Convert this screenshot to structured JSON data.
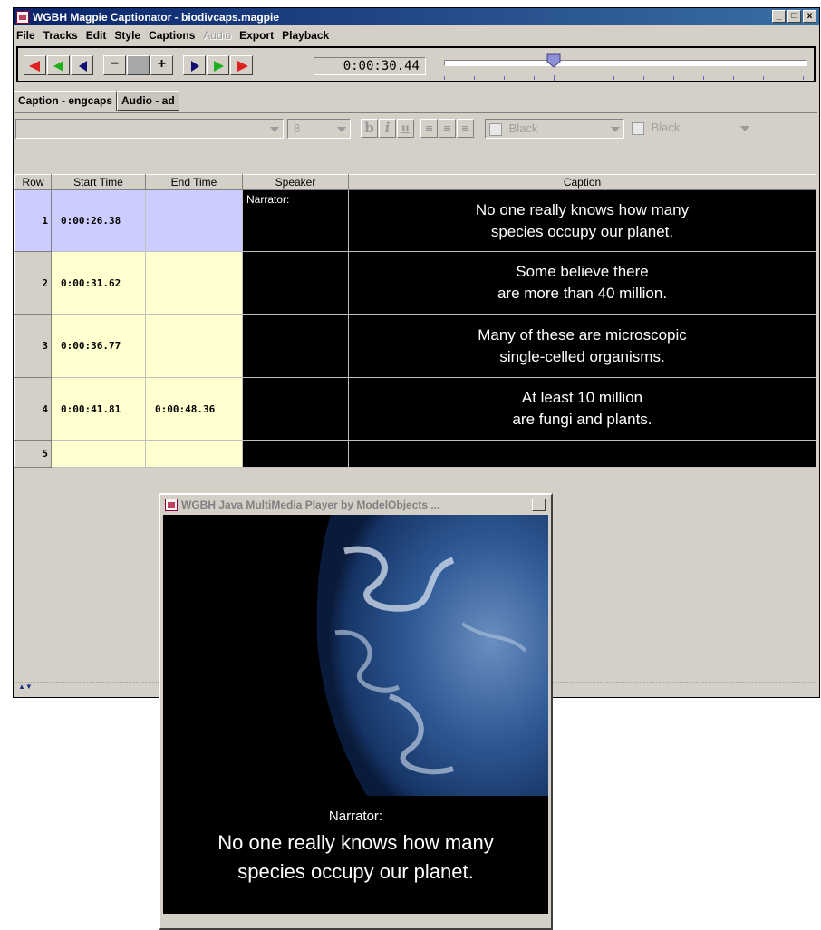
{
  "main_window": {
    "title": "WGBH Magpie Captionator - biodivcaps.magpie",
    "controls": {
      "minimize": "_",
      "maximize": "□",
      "close": "x"
    }
  },
  "menu": [
    "File",
    "Tracks",
    "Edit",
    "Style",
    "Captions",
    "Audio",
    "Export",
    "Playback"
  ],
  "menu_disabled": [
    "Audio"
  ],
  "toolbar": {
    "timecode": "0:00:30.44",
    "minus_label": "−",
    "plus_label": "+",
    "slider_position": 0.3
  },
  "tabs": [
    "Caption - engcaps",
    "Audio - ad"
  ],
  "format_bar": {
    "font_size": "8",
    "bold": "b",
    "italic": "i",
    "underline": "u",
    "fg_color": "Black",
    "bg_color": "Black"
  },
  "grid": {
    "columns": [
      "Row",
      "Start Time",
      "End Time",
      "Speaker",
      "Caption"
    ],
    "rows": [
      {
        "row": "1",
        "start": "0:00:26.38",
        "end": "",
        "speaker": "Narrator:",
        "caption_l1": "No one really knows how many",
        "caption_l2": "species occupy our planet."
      },
      {
        "row": "2",
        "start": "0:00:31.62",
        "end": "",
        "speaker": "",
        "caption_l1": "Some believe there",
        "caption_l2": "are more than 40 million."
      },
      {
        "row": "3",
        "start": "0:00:36.77",
        "end": "",
        "speaker": "",
        "caption_l1": "Many of these are microscopic",
        "caption_l2": "single-celled organisms."
      },
      {
        "row": "4",
        "start": "0:00:41.81",
        "end": "0:00:48.36",
        "speaker": "",
        "caption_l1": "At least 10 million",
        "caption_l2": "are fungi and plants."
      },
      {
        "row": "5",
        "start": "",
        "end": "",
        "speaker": "",
        "caption_l1": "",
        "caption_l2": ""
      }
    ]
  },
  "player": {
    "title": "WGBH Java MultiMedia Player by ModelObjects ...",
    "close": "x",
    "speaker": "Narrator:",
    "caption_l1": "No one really knows how many",
    "caption_l2": "species occupy our planet."
  },
  "colors": {
    "title_start": "#0a246a",
    "title_end": "#3a6ea5",
    "selected_row": "#ccccff",
    "time_cell": "#ffffd0",
    "caption_bg": "#000000"
  }
}
